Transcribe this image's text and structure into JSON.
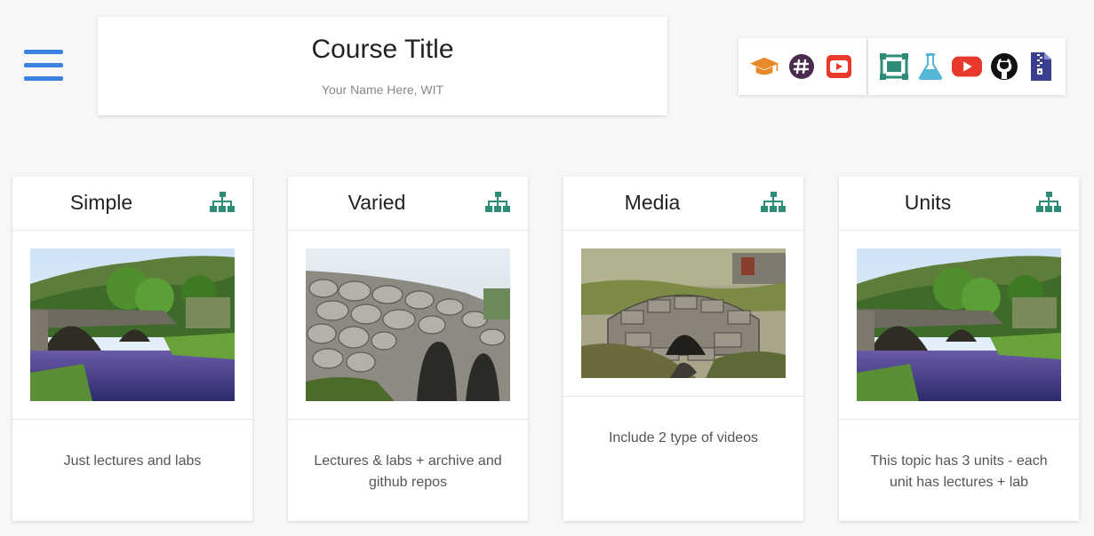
{
  "header": {
    "title": "Course Title",
    "subtitle": "Your Name Here, WIT"
  },
  "icons_left": [
    "graduation-cap-icon",
    "slack-icon",
    "youtube-icon"
  ],
  "icons_right": [
    "screen-capture-icon",
    "flask-icon",
    "youtube-icon",
    "github-icon",
    "zip-file-icon"
  ],
  "colors": {
    "accent_blue": "#3b82e0",
    "teal": "#2e8b77",
    "orange": "#e88a2a",
    "slack_purple": "#4a2c4e",
    "youtube_red": "#e8392c",
    "flask_blue": "#55b7d6",
    "zip_navy": "#3a3f8f"
  },
  "cards": [
    {
      "title": "Simple",
      "description": "Just lectures and labs"
    },
    {
      "title": "Varied",
      "description": "Lectures & labs + archive and github repos"
    },
    {
      "title": "Media",
      "description": "Include 2 type of videos"
    },
    {
      "title": "Units",
      "description": "This topic has 3 units - each unit has lectures + lab"
    }
  ]
}
